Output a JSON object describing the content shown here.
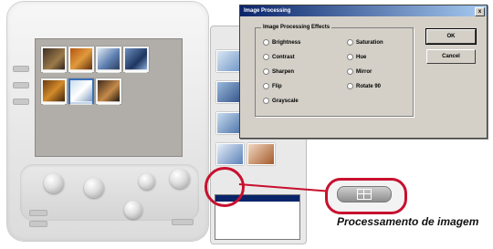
{
  "dialog": {
    "title": "Image Processing",
    "close_glyph": "x",
    "group_label": "Image Processing Effects",
    "effects_left": [
      "Brightness",
      "Contrast",
      "Sharpen",
      "Flip",
      "Grayscale"
    ],
    "effects_right": [
      "Saturation",
      "Hue",
      "Mirror",
      "Rotate 90"
    ],
    "ok_label": "OK",
    "cancel_label": "Cancel"
  },
  "callout": {
    "caption": "Processamento de imagem",
    "accent_color": "#c8102e",
    "icon": "grid-icon"
  }
}
